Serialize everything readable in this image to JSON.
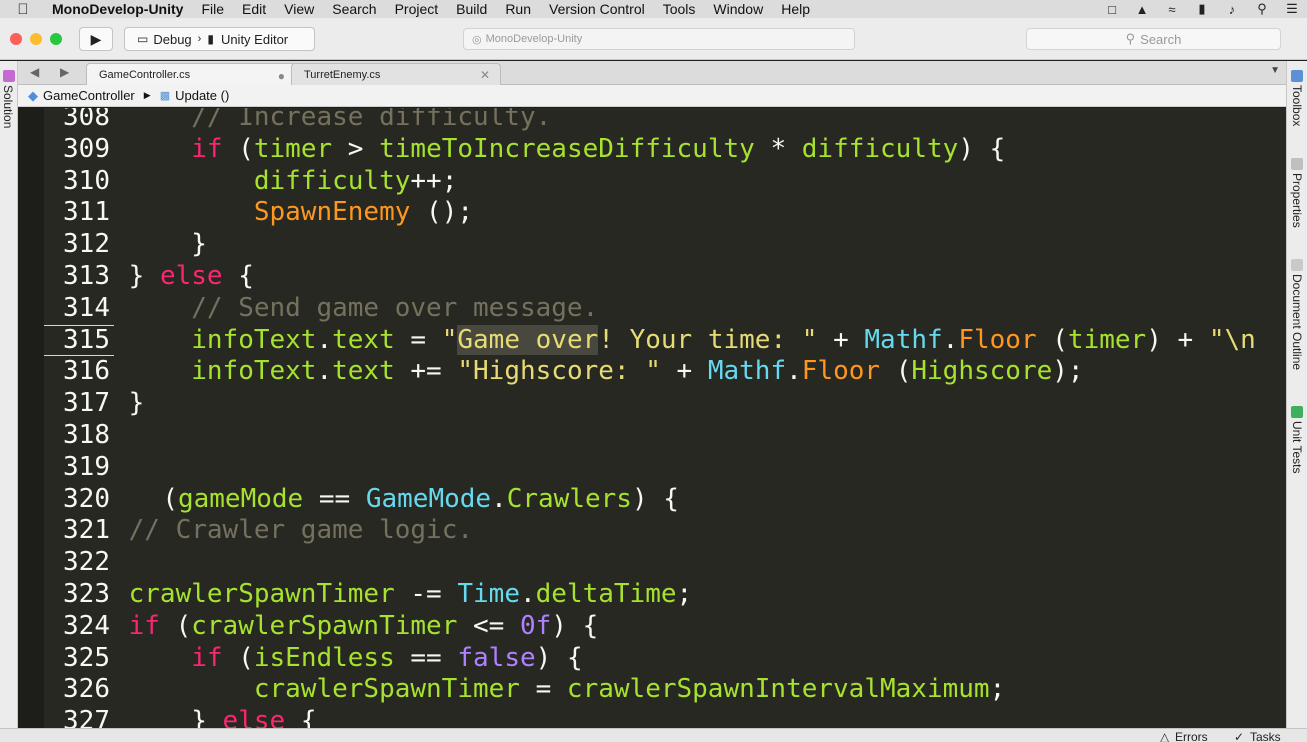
{
  "menubar": {
    "app_name": "MonoDevelop-Unity",
    "items": [
      "File",
      "Edit",
      "View",
      "Search",
      "Project",
      "Build",
      "Run",
      "Version Control",
      "Tools",
      "Window",
      "Help"
    ],
    "status_icons": [
      "selection-icon",
      "drive-icon",
      "wifi-icon",
      "battery-icon",
      "volume-icon",
      "spotlight-icon",
      "list-icon"
    ]
  },
  "toolbar": {
    "config": "Debug",
    "target": "Unity Editor",
    "address": "MonoDevelop-Unity",
    "search_placeholder": "Search"
  },
  "tabs": [
    {
      "label": "GameController.cs",
      "active": true
    },
    {
      "label": "TurretEnemy.cs",
      "active": false
    }
  ],
  "breadcrumb": {
    "class_name": "GameController",
    "method_name": "Update ()"
  },
  "left_pad": {
    "label": "Solution"
  },
  "right_pad": {
    "toolbox": "Toolbox",
    "properties": "Properties",
    "document_outline": "Document Outline",
    "unit_tests": "Unit Tests"
  },
  "editor": {
    "line_numbers": [
      "308",
      "309",
      "310",
      "311",
      "312",
      "313",
      "314",
      "315",
      "316",
      "317",
      "318",
      "319",
      "320",
      "321",
      "322",
      "323",
      "324",
      "325",
      "326",
      "327"
    ],
    "current_line": "315"
  },
  "status": {
    "errors": "Errors",
    "tasks": "Tasks"
  },
  "colors": {
    "keyword": "#f92672",
    "identifier": "#a6e22e",
    "function": "#fd971f",
    "type": "#66d9ef",
    "string": "#e6db74",
    "comment": "#75715e",
    "number": "#ae81ff",
    "background": "#272822"
  }
}
